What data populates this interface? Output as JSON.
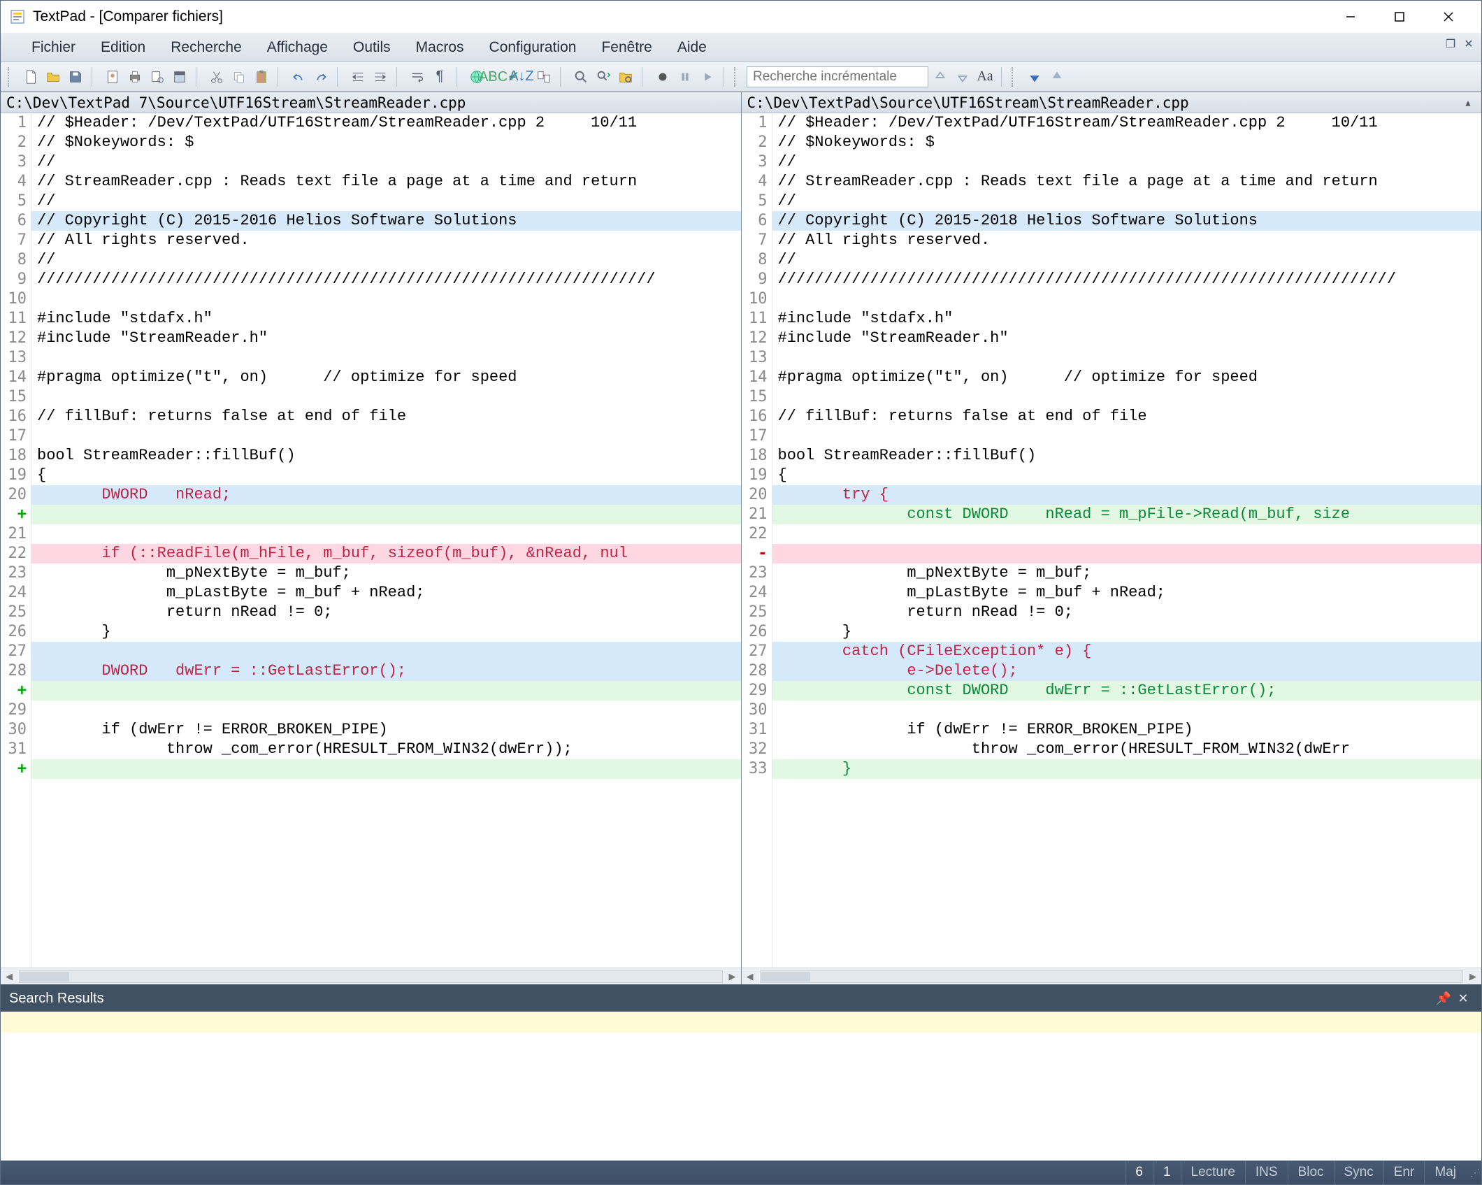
{
  "title": "TextPad - [Comparer fichiers]",
  "menu": [
    "Fichier",
    "Edition",
    "Recherche",
    "Affichage",
    "Outils",
    "Macros",
    "Configuration",
    "Fenêtre",
    "Aide"
  ],
  "search_placeholder": "Recherche incrémentale",
  "left": {
    "path": "C:\\Dev\\TextPad 7\\Source\\UTF16Stream\\StreamReader.cpp",
    "lines": [
      {
        "n": "1",
        "t": "// $Header: /Dev/TextPad/UTF16Stream/StreamReader.cpp 2     10/11"
      },
      {
        "n": "2",
        "t": "// $Nokeywords: $"
      },
      {
        "n": "3",
        "t": "//"
      },
      {
        "n": "4",
        "t": "// StreamReader.cpp : Reads text file a page at a time and return"
      },
      {
        "n": "5",
        "t": "//"
      },
      {
        "n": "6",
        "t": "// Copyright (C) 2015-2016 Helios Software Solutions",
        "cls": "hl-change",
        "arrow": true
      },
      {
        "n": "7",
        "t": "// All rights reserved."
      },
      {
        "n": "8",
        "t": "//"
      },
      {
        "n": "9",
        "t": "///////////////////////////////////////////////////////////////////"
      },
      {
        "n": "10",
        "t": ""
      },
      {
        "n": "11",
        "t": "#include \"stdafx.h\""
      },
      {
        "n": "12",
        "t": "#include \"StreamReader.h\""
      },
      {
        "n": "13",
        "t": ""
      },
      {
        "n": "14",
        "t": "#pragma optimize(\"t\", on)      // optimize for speed"
      },
      {
        "n": "15",
        "t": ""
      },
      {
        "n": "16",
        "t": "// fillBuf: returns false at end of file"
      },
      {
        "n": "17",
        "t": ""
      },
      {
        "n": "18",
        "t": "bool StreamReader::fillBuf()"
      },
      {
        "n": "19",
        "t": "{"
      },
      {
        "n": "20",
        "cls": "hl-change",
        "html": "       <span class='tok-kw'>DWORD   nRead;</span>"
      },
      {
        "n": "+",
        "gcls": "plus",
        "t": "",
        "cls": "hl-add"
      },
      {
        "n": "21",
        "t": ""
      },
      {
        "n": "22",
        "cls": "hl-del",
        "html": "       <span class='tok-kw'>if (::ReadFile(m_hFile, m_buf, sizeof(m_buf), &nRead, nul</span>"
      },
      {
        "n": "23",
        "t": "              m_pNextByte = m_buf;"
      },
      {
        "n": "24",
        "t": "              m_pLastByte = m_buf + nRead;"
      },
      {
        "n": "25",
        "t": "              return nRead != 0;"
      },
      {
        "n": "26",
        "t": "       }"
      },
      {
        "n": "27",
        "t": "",
        "cls": "hl-change"
      },
      {
        "n": "28",
        "cls": "hl-change",
        "html": "       <span class='tok-kw'>DWORD   dwErr = ::GetLastError();</span>"
      },
      {
        "n": "+",
        "gcls": "plus",
        "t": "",
        "cls": "hl-add"
      },
      {
        "n": "29",
        "t": ""
      },
      {
        "n": "30",
        "t": "       if (dwErr != ERROR_BROKEN_PIPE)"
      },
      {
        "n": "31",
        "t": "              throw _com_error(HRESULT_FROM_WIN32(dwErr));"
      },
      {
        "n": "+",
        "gcls": "plus",
        "t": "",
        "cls": "hl-add"
      },
      {
        "n": "",
        "t": ""
      }
    ]
  },
  "right": {
    "path": "C:\\Dev\\TextPad\\Source\\UTF16Stream\\StreamReader.cpp",
    "lines": [
      {
        "n": "1",
        "t": "// $Header: /Dev/TextPad/UTF16Stream/StreamReader.cpp 2     10/11"
      },
      {
        "n": "2",
        "t": "// $Nokeywords: $"
      },
      {
        "n": "3",
        "t": "//"
      },
      {
        "n": "4",
        "t": "// StreamReader.cpp : Reads text file a page at a time and return"
      },
      {
        "n": "5",
        "t": "//"
      },
      {
        "n": "6",
        "t": "// Copyright (C) 2015-2018 Helios Software Solutions",
        "cls": "hl-change"
      },
      {
        "n": "7",
        "t": "// All rights reserved."
      },
      {
        "n": "8",
        "t": "//"
      },
      {
        "n": "9",
        "t": "///////////////////////////////////////////////////////////////////"
      },
      {
        "n": "10",
        "t": ""
      },
      {
        "n": "11",
        "t": "#include \"stdafx.h\""
      },
      {
        "n": "12",
        "t": "#include \"StreamReader.h\""
      },
      {
        "n": "13",
        "t": ""
      },
      {
        "n": "14",
        "t": "#pragma optimize(\"t\", on)      // optimize for speed"
      },
      {
        "n": "15",
        "t": ""
      },
      {
        "n": "16",
        "t": "// fillBuf: returns false at end of file"
      },
      {
        "n": "17",
        "t": ""
      },
      {
        "n": "18",
        "t": "bool StreamReader::fillBuf()"
      },
      {
        "n": "19",
        "t": "{"
      },
      {
        "n": "20",
        "cls": "hl-change",
        "html": "       <span class='tok-kw'>try {</span>"
      },
      {
        "n": "21",
        "cls": "hl-add",
        "html": "              <span class='tok-green'>const DWORD    nRead = m_pFile->Read(m_buf, size</span>"
      },
      {
        "n": "22",
        "t": ""
      },
      {
        "n": "-",
        "gcls": "minus",
        "t": "",
        "cls": "hl-del"
      },
      {
        "n": "23",
        "t": "              m_pNextByte = m_buf;"
      },
      {
        "n": "24",
        "t": "              m_pLastByte = m_buf + nRead;"
      },
      {
        "n": "25",
        "t": "              return nRead != 0;"
      },
      {
        "n": "26",
        "t": "       }"
      },
      {
        "n": "27",
        "cls": "hl-change",
        "html": "       <span class='tok-kw'>catch (CFileException* e) {</span>"
      },
      {
        "n": "28",
        "cls": "hl-change",
        "html": "              <span class='tok-kw'>e->Delete();</span>"
      },
      {
        "n": "29",
        "cls": "hl-add",
        "html": "              <span class='tok-green'>const DWORD    dwErr = ::GetLastError();</span>"
      },
      {
        "n": "30",
        "t": ""
      },
      {
        "n": "31",
        "t": "              if (dwErr != ERROR_BROKEN_PIPE)"
      },
      {
        "n": "32",
        "t": "                     throw _com_error(HRESULT_FROM_WIN32(dwErr"
      },
      {
        "n": "33",
        "cls": "hl-add",
        "html": "       <span class='tok-green'>}</span>"
      },
      {
        "n": "",
        "t": ""
      }
    ]
  },
  "search_results_title": "Search Results",
  "status": {
    "col": "6",
    "line": "1",
    "cells": [
      "Lecture",
      "INS",
      "Bloc",
      "Sync",
      "Enr",
      "Maj"
    ]
  }
}
